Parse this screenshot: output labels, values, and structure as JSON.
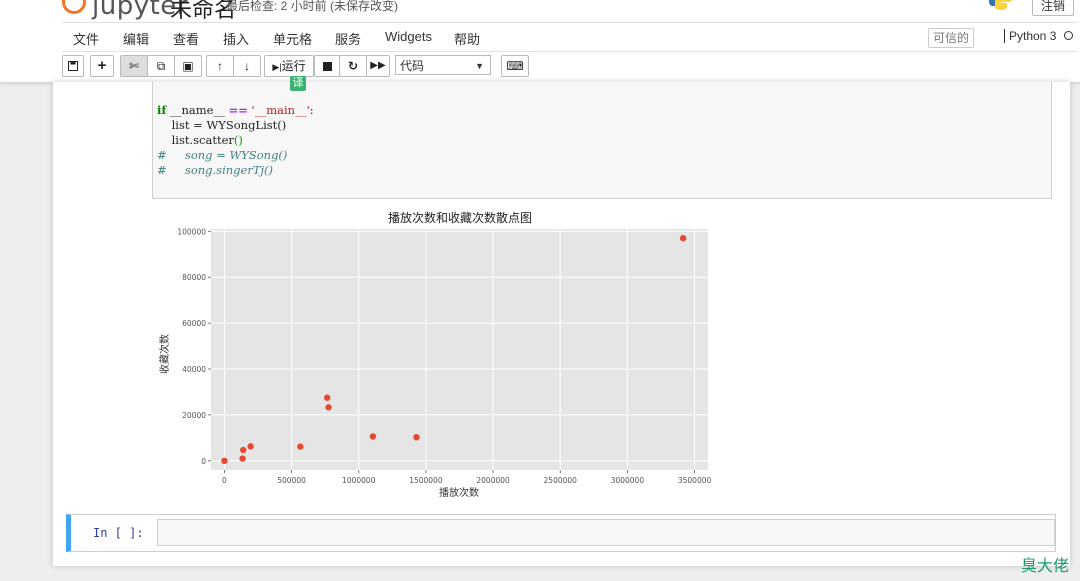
{
  "header": {
    "logo_text": "jupyter",
    "notebook_name": "未命名",
    "save_status": "最后检查: 2 小时前 (未保存改变)",
    "logout_label": "注销"
  },
  "menubar": {
    "items": [
      "文件",
      "编辑",
      "查看",
      "插入",
      "单元格",
      "服务",
      "Widgets",
      "帮助"
    ],
    "trusted_label": "可信的",
    "kernel_name": "Python 3"
  },
  "toolbar": {
    "save_icon": "save-icon",
    "add_icon": "plus-icon",
    "run_label": "运行",
    "cell_type": "代码",
    "translate_badge": "译"
  },
  "code": {
    "line1_kw": "if",
    "line1_name": " __name__ ",
    "line1_op": "==",
    "line1_str": " '__main__'",
    "line1_end": ":",
    "line2": "    list = WYSongList()",
    "line3_a": "    list.scatter",
    "line3_b": "()",
    "line4": "#     song = WYSong()",
    "line5": "#     song.singerTj()"
  },
  "chart_data": {
    "type": "scatter",
    "title": "播放次数和收藏次数散点图",
    "xlabel": "播放次数",
    "ylabel": "收藏次数",
    "xlim": [
      -100000,
      3600000
    ],
    "ylim": [
      -4000,
      101000
    ],
    "xticks": [
      0,
      500000,
      1000000,
      1500000,
      2000000,
      2500000,
      3000000,
      3500000
    ],
    "yticks": [
      0,
      20000,
      40000,
      60000,
      80000,
      100000
    ],
    "grid": true,
    "point_color": "#e24a33",
    "background": "#e5e5e5",
    "points": [
      {
        "x": 0,
        "y": 0
      },
      {
        "x": 135000,
        "y": 1000
      },
      {
        "x": 140000,
        "y": 4700
      },
      {
        "x": 195000,
        "y": 6300
      },
      {
        "x": 565000,
        "y": 6200
      },
      {
        "x": 765000,
        "y": 27500
      },
      {
        "x": 775000,
        "y": 23300
      },
      {
        "x": 1105000,
        "y": 10600
      },
      {
        "x": 1430000,
        "y": 10300
      },
      {
        "x": 3415000,
        "y": 97000
      }
    ]
  },
  "input_cell": {
    "prompt": "In [ ]:"
  },
  "watermark": "臭大佬"
}
